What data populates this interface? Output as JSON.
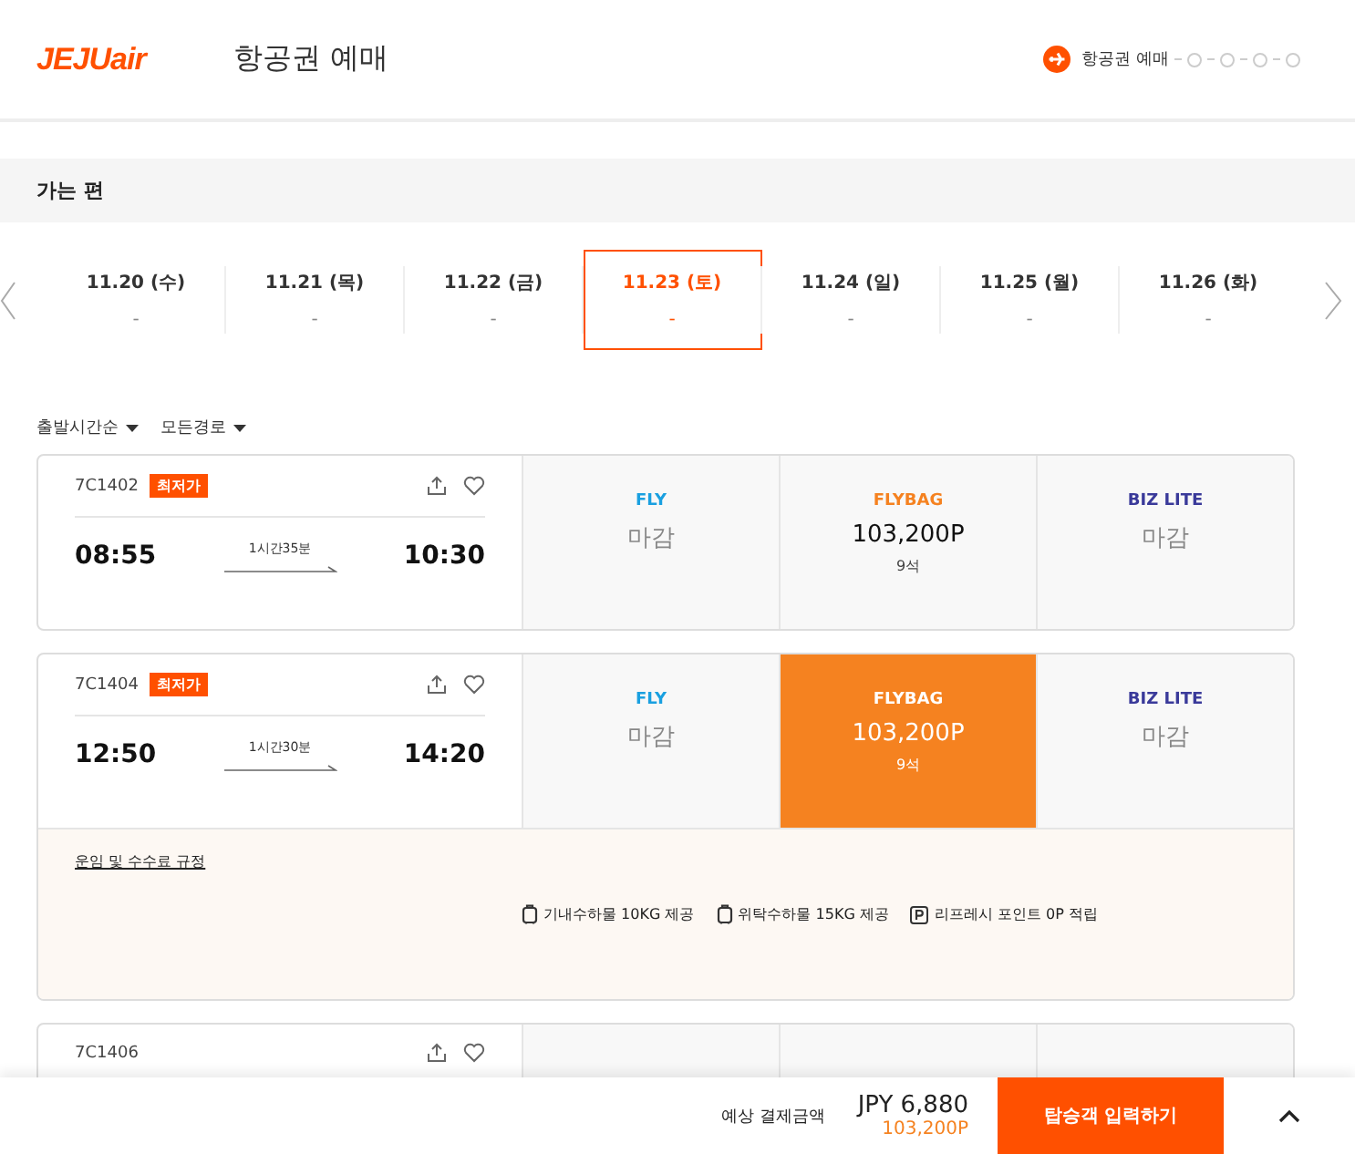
{
  "header": {
    "logo": "JEJUair",
    "title": "항공권 예매",
    "step_label": "항공권 예매"
  },
  "section_title": "가는 편",
  "dates": [
    {
      "date": "11.20 (수)",
      "price": "-",
      "selected": false
    },
    {
      "date": "11.21 (목)",
      "price": "-",
      "selected": false
    },
    {
      "date": "11.22 (금)",
      "price": "-",
      "selected": false
    },
    {
      "date": "11.23 (토)",
      "price": "-",
      "selected": true
    },
    {
      "date": "11.24 (일)",
      "price": "-",
      "selected": false
    },
    {
      "date": "11.25 (월)",
      "price": "-",
      "selected": false
    },
    {
      "date": "11.26 (화)",
      "price": "-",
      "selected": false
    }
  ],
  "filters": [
    "출발시간순",
    "모든경로"
  ],
  "flights": [
    {
      "number": "7C1402",
      "badge": "최저가",
      "depart": "08:55",
      "duration": "1시간35분",
      "arrive": "10:30",
      "fares": [
        {
          "kind": "fly",
          "name": "FLY",
          "status": "마감",
          "selected": false
        },
        {
          "kind": "flybag",
          "name": "FLYBAG",
          "price": "103,200P",
          "seats": "9석",
          "selected": false
        },
        {
          "kind": "biz",
          "name": "BIZ LITE",
          "status": "마감",
          "selected": false
        }
      ]
    },
    {
      "number": "7C1404",
      "badge": "최저가",
      "depart": "12:50",
      "duration": "1시간30분",
      "arrive": "14:20",
      "fares": [
        {
          "kind": "fly",
          "name": "FLY",
          "status": "마감",
          "selected": false
        },
        {
          "kind": "flybag",
          "name": "FLYBAG",
          "price": "103,200P",
          "seats": "9석",
          "selected": true
        },
        {
          "kind": "biz",
          "name": "BIZ LITE",
          "status": "마감",
          "selected": false
        }
      ],
      "details": {
        "link": "운임 및 수수료 규정",
        "benefits": [
          {
            "kind": "bag",
            "text": "기내수하물 10KG 제공"
          },
          {
            "kind": "bag",
            "text": "위탁수하물 15KG 제공"
          },
          {
            "kind": "point",
            "text": "리프레시 포인트 0P 적립"
          }
        ]
      }
    },
    {
      "number": "7C1406",
      "fares": [
        {
          "selected": false
        },
        {
          "selected": false
        },
        {
          "selected": false
        }
      ]
    }
  ],
  "footer": {
    "label": "예상 결제금액",
    "amount": "JPY 6,880",
    "points": "103,200P",
    "button": "탑승객 입력하기"
  }
}
